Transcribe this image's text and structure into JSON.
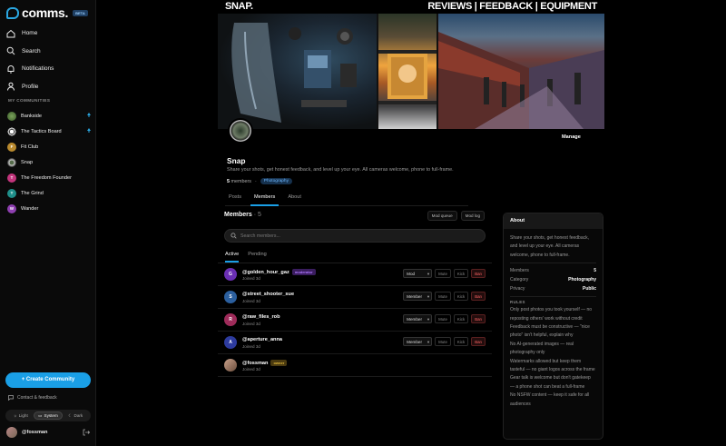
{
  "app": {
    "logo_text": "comms.",
    "badge": "BETA"
  },
  "nav": [
    {
      "label": "Home",
      "icon": "home-icon"
    },
    {
      "label": "Search",
      "icon": "search-icon"
    },
    {
      "label": "Notifications",
      "icon": "bell-icon"
    },
    {
      "label": "Profile",
      "icon": "person-icon"
    }
  ],
  "communities_header": "MY COMMUNITIES",
  "communities": [
    {
      "label": "Bankside",
      "initial": "",
      "color": "#4f7d3a",
      "unread": true
    },
    {
      "label": "The Tactics Board",
      "initial": "",
      "color": "#d8d8d8",
      "unread": true
    },
    {
      "label": "Fit Club",
      "initial": "F",
      "color": "#b98a2e",
      "unread": false
    },
    {
      "label": "Snap",
      "initial": "",
      "color": "#3e4e3a",
      "unread": false
    },
    {
      "label": "The Freedom Founder",
      "initial": "T",
      "color": "#c2357c",
      "unread": false
    },
    {
      "label": "The Grind",
      "initial": "T",
      "color": "#1f8f8a",
      "unread": false
    },
    {
      "label": "Wander",
      "initial": "W",
      "color": "#8e3fb0",
      "unread": false
    }
  ],
  "create_button": "+ Create Community",
  "contact": "Contact & feedback",
  "theme": {
    "light": "Light",
    "system": "System",
    "dark": "Dark"
  },
  "user": {
    "name": "@fossman"
  },
  "site": {
    "brand": "SNAP.",
    "topnav": "REVIEWS | FEEDBACK | EQUIPMENT"
  },
  "community": {
    "name": "Snap",
    "manage": "Manage",
    "description": "Share your shots, get honest feedback, and level up your eye. All cameras welcome, phone to full-frame.",
    "members_count": "5",
    "members_word": "members",
    "tag": "Photography"
  },
  "tabs": [
    "Posts",
    "Members",
    "About"
  ],
  "members_panel": {
    "title": "Members",
    "count": "· 5",
    "mod_queue": "Mod queue",
    "mod_log": "Mod log",
    "search_placeholder": "Search members...",
    "subtabs": [
      "Active",
      "Pending"
    ]
  },
  "members": [
    {
      "handle": "@golden_hour_gaz",
      "joined": "Joined 3d",
      "initial": "G",
      "color": "#6a2fb3",
      "role_badge": "moderator",
      "select": "Mod",
      "actions": true
    },
    {
      "handle": "@street_shooter_sue",
      "joined": "Joined 3d",
      "initial": "S",
      "color": "#2b5f9e",
      "role_badge": "",
      "select": "Member",
      "actions": true
    },
    {
      "handle": "@raw_files_rob",
      "joined": "Joined 3d",
      "initial": "R",
      "color": "#9e2b5a",
      "role_badge": "",
      "select": "Member",
      "actions": true
    },
    {
      "handle": "@aperture_anna",
      "joined": "Joined 3d",
      "initial": "A",
      "color": "#2d3b9e",
      "role_badge": "",
      "select": "Member",
      "actions": true
    },
    {
      "handle": "@fossman",
      "joined": "Joined 3d",
      "initial": "",
      "color": "#8a6b5a",
      "role_badge": "owner",
      "select": "",
      "actions": false
    }
  ],
  "action_labels": {
    "mute": "Mute",
    "kick": "Kick",
    "ban": "Ban"
  },
  "about": {
    "title": "About",
    "description": "Share your shots, get honest feedback, and level up your eye. All cameras welcome, phone to full-frame.",
    "members_label": "Members",
    "members_value": "5",
    "category_label": "Category",
    "category_value": "Photography",
    "privacy_label": "Privacy",
    "privacy_value": "Public",
    "rules_title": "RULES",
    "rules": [
      "Only post photos you took yourself — no reposting others' work without credit",
      "Feedback must be constructive — \"nice photo\" isn't helpful, explain why",
      "No AI-generated images — real photography only",
      "Watermarks allowed but keep them tasteful — no giant logos across the frame",
      "Gear talk is welcome but don't gatekeep — a phone shot can beat a full-frame",
      "No NSFW content — keep it safe for all audiences"
    ]
  },
  "colors": {
    "accent": "#1a9fe6",
    "danger": "#ff6464",
    "moderator": "#b079ff",
    "owner": "#e2b93b"
  }
}
